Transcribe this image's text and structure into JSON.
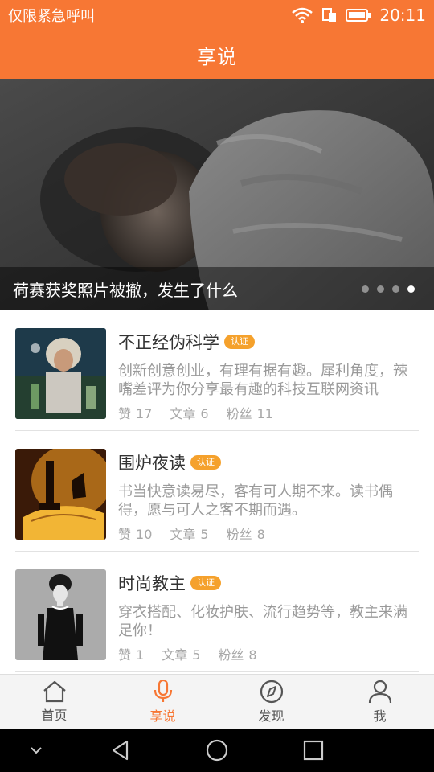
{
  "status_bar": {
    "carrier": "仅限紧急呼叫",
    "time": "20:11"
  },
  "header": {
    "title": "享说"
  },
  "banner": {
    "caption": "荷赛获奖照片被撤，发生了什么",
    "dots_total": 4,
    "active_dot": 3
  },
  "items": [
    {
      "title": "不正经伪科学",
      "badge": "认证",
      "desc": "创新创意创业，有理有据有趣。犀利角度，辣嘴差评为你分享最有趣的科技互联网资讯",
      "likes_label": "赞",
      "likes": "17",
      "articles_label": "文章",
      "articles": "6",
      "fans_label": "粉丝",
      "fans": "11"
    },
    {
      "title": "围炉夜读",
      "badge": "认证",
      "desc": "书当快意读易尽，客有可人期不来。读书偶得，愿与可人之客不期而遇。",
      "likes_label": "赞",
      "likes": "10",
      "articles_label": "文章",
      "articles": "5",
      "fans_label": "粉丝",
      "fans": "8"
    },
    {
      "title": "时尚教主",
      "badge": "认证",
      "desc": "穿衣搭配、化妆护肤、流行趋势等，教主来满足你！",
      "likes_label": "赞",
      "likes": "1",
      "articles_label": "文章",
      "articles": "5",
      "fans_label": "粉丝",
      "fans": "8"
    }
  ],
  "tabs": [
    {
      "label": "首页",
      "icon": "home-icon"
    },
    {
      "label": "享说",
      "icon": "microphone-icon",
      "active": true
    },
    {
      "label": "发现",
      "icon": "compass-icon"
    },
    {
      "label": "我",
      "icon": "person-icon"
    }
  ],
  "colors": {
    "accent": "#f77734",
    "badge": "#f5a12c"
  }
}
